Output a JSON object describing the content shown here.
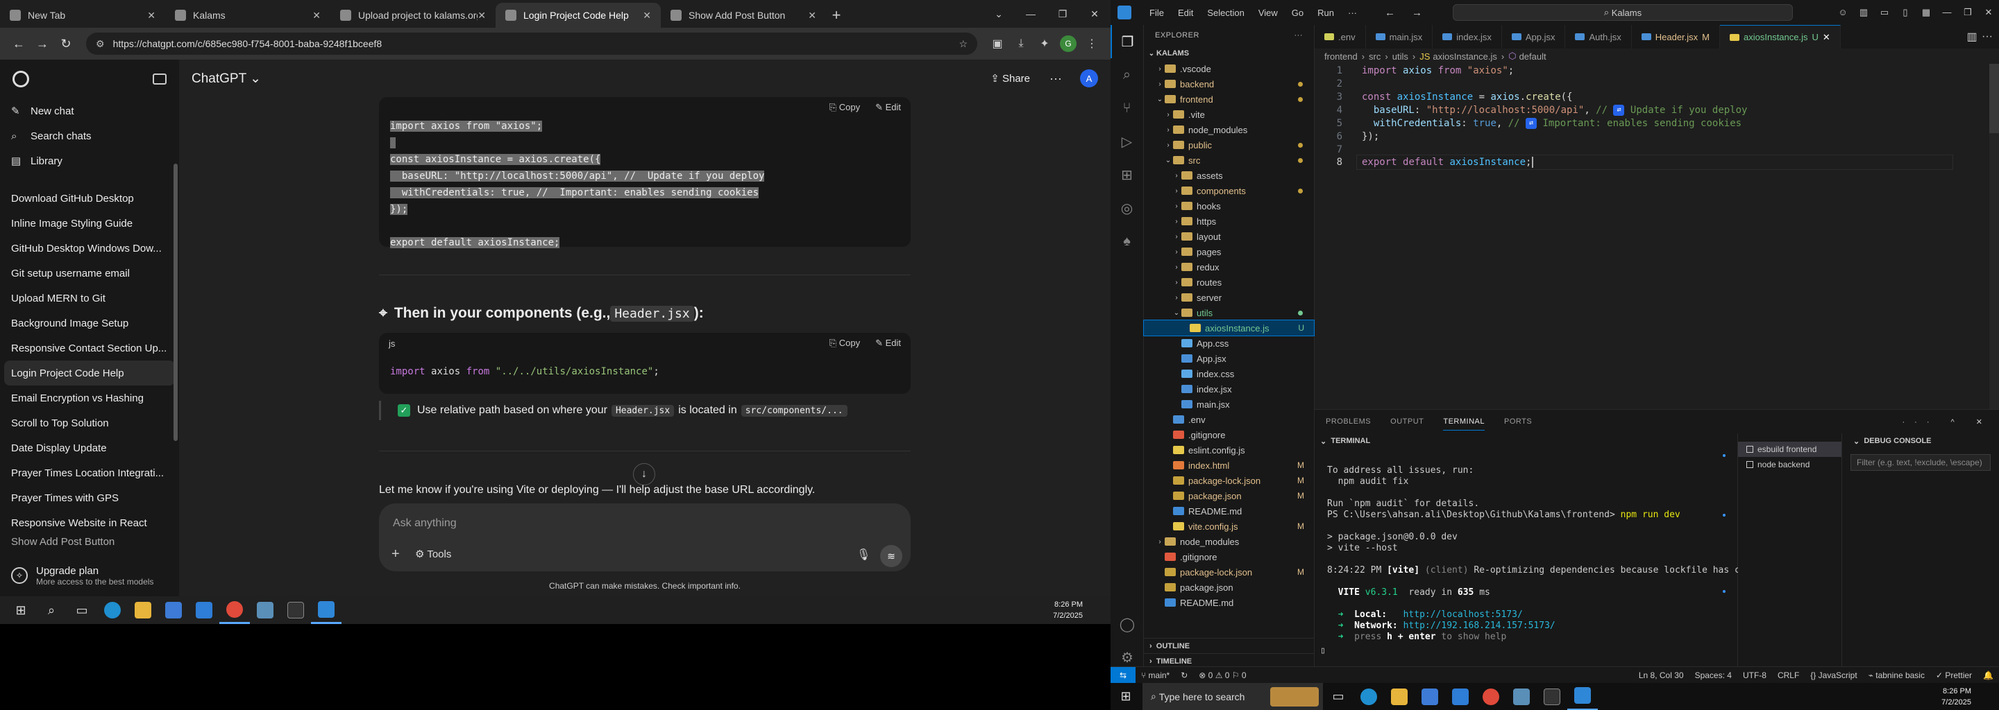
{
  "browser": {
    "tabs": [
      {
        "label": "New Tab",
        "close": "✕"
      },
      {
        "label": "Kalams",
        "close": "✕"
      },
      {
        "label": "Upload project to kalams.org",
        "close": "✕"
      },
      {
        "label": "Login Project Code Help",
        "close": "✕",
        "active": true
      },
      {
        "label": "Show Add Post Button",
        "close": "✕"
      }
    ],
    "new_tab": "+",
    "url": "https://chatgpt.com/c/685ec980-f754-8001-baba-9248f1bceef8"
  },
  "chatgpt": {
    "sidebar": {
      "actions": [
        {
          "icon": "✎",
          "label": "New chat"
        },
        {
          "icon": "⌕",
          "label": "Search chats"
        },
        {
          "icon": "▤",
          "label": "Library"
        }
      ],
      "history": [
        "Download GitHub Desktop",
        "Inline Image Styling Guide",
        "GitHub Desktop Windows Dow...",
        "Git setup username email",
        "Upload MERN to Git",
        "Background Image Setup",
        "Responsive Contact Section Up...",
        "Login Project Code Help",
        "Email Encryption vs Hashing",
        "Scroll to Top Solution",
        "Date Display Update",
        "Prayer Times Location Integrati...",
        "Prayer Times with GPS",
        "Responsive Website in React",
        "Show Add Post Button"
      ],
      "selected_index": 7,
      "upgrade_title": "Upgrade plan",
      "upgrade_sub": "More access to the best models"
    },
    "header": {
      "model": "ChatGPT",
      "share": "Share",
      "avatar": "A"
    },
    "code1": {
      "copy": "Copy",
      "edit": "Edit",
      "lines": [
        "import axios from \"axios\";",
        "",
        "const axiosInstance = axios.create({",
        "  baseURL: \"http://localhost:5000/api\", //  Update if you deploy",
        "  withCredentials: true, //  Important: enables sending cookies",
        "});",
        "",
        "export default axiosInstance;"
      ]
    },
    "section_heading_pre": "Then in your components (e.g., ",
    "section_heading_code": "Header.jsx",
    "section_heading_post": "):",
    "code2": {
      "lang": "js",
      "copy": "Copy",
      "edit": "Edit",
      "kw": "import",
      "ident": "axios",
      "from": "from",
      "path": "\"../../utils/axiosInstance\"",
      "semi": ";"
    },
    "note": {
      "pre": "Use relative path based on where your",
      "code1": "Header.jsx",
      "mid": "is located in",
      "code2": "src/components/..."
    },
    "last_message": "Let me know if you're using Vite or deploying — I'll help adjust the base URL accordingly.",
    "composer": {
      "placeholder": "Ask anything",
      "tools": "Tools"
    },
    "disclaimer": "ChatGPT can make mistakes. Check important info."
  },
  "left_taskbar": {
    "time": "8:26 PM",
    "date": "7/2/2025"
  },
  "vscode": {
    "menu": [
      "File",
      "Edit",
      "Selection",
      "View",
      "Go",
      "Run",
      "···"
    ],
    "search": "Kalams",
    "explorer_title": "EXPLORER",
    "root": "KALAMS",
    "tree": [
      {
        "name": ".vscode",
        "depth": 1,
        "type": "folder",
        "chev": "›"
      },
      {
        "name": "backend",
        "depth": 1,
        "type": "folder",
        "chev": "›",
        "color": "yel",
        "dot": true
      },
      {
        "name": "frontend",
        "depth": 1,
        "type": "folder",
        "chev": "⌄",
        "color": "yel",
        "dot": true
      },
      {
        "name": ".vite",
        "depth": 2,
        "type": "folder",
        "chev": "›"
      },
      {
        "name": "node_modules",
        "depth": 2,
        "type": "folder",
        "chev": "›"
      },
      {
        "name": "public",
        "depth": 2,
        "type": "folder",
        "chev": "›",
        "color": "yel",
        "dot": true
      },
      {
        "name": "src",
        "depth": 2,
        "type": "folder",
        "chev": "⌄",
        "color": "yel",
        "dot": true
      },
      {
        "name": "assets",
        "depth": 3,
        "type": "folder",
        "chev": "›"
      },
      {
        "name": "components",
        "depth": 3,
        "type": "folder",
        "chev": "›",
        "color": "yel",
        "dot": true
      },
      {
        "name": "hooks",
        "depth": 3,
        "type": "folder",
        "chev": "›"
      },
      {
        "name": "https",
        "depth": 3,
        "type": "folder",
        "chev": "›"
      },
      {
        "name": "layout",
        "depth": 3,
        "type": "folder",
        "chev": "›"
      },
      {
        "name": "pages",
        "depth": 3,
        "type": "folder",
        "chev": "›"
      },
      {
        "name": "redux",
        "depth": 3,
        "type": "folder",
        "chev": "›"
      },
      {
        "name": "routes",
        "depth": 3,
        "type": "folder",
        "chev": "›"
      },
      {
        "name": "server",
        "depth": 3,
        "type": "folder",
        "chev": "›"
      },
      {
        "name": "utils",
        "depth": 3,
        "type": "folder",
        "chev": "⌄",
        "color": "green",
        "dot": true,
        "dotgreen": true
      },
      {
        "name": "axiosInstance.js",
        "depth": 4,
        "type": "js",
        "color": "green",
        "badge": "U",
        "selected": true
      },
      {
        "name": "App.css",
        "depth": 3,
        "type": "css"
      },
      {
        "name": "App.jsx",
        "depth": 3,
        "type": "file"
      },
      {
        "name": "index.css",
        "depth": 3,
        "type": "css"
      },
      {
        "name": "index.jsx",
        "depth": 3,
        "type": "file"
      },
      {
        "name": "main.jsx",
        "depth": 3,
        "type": "file"
      },
      {
        "name": ".env",
        "depth": 2,
        "type": "file"
      },
      {
        "name": ".gitignore",
        "depth": 2,
        "type": "git"
      },
      {
        "name": "eslint.config.js",
        "depth": 2,
        "type": "js"
      },
      {
        "name": "index.html",
        "depth": 2,
        "type": "html",
        "color": "yel",
        "badge": "M"
      },
      {
        "name": "package-lock.json",
        "depth": 2,
        "type": "json",
        "color": "yel",
        "badge": "M"
      },
      {
        "name": "package.json",
        "depth": 2,
        "type": "json",
        "color": "yel",
        "badge": "M"
      },
      {
        "name": "README.md",
        "depth": 2,
        "type": "md"
      },
      {
        "name": "vite.config.js",
        "depth": 2,
        "type": "js",
        "color": "yel",
        "badge": "M"
      },
      {
        "name": "node_modules",
        "depth": 1,
        "type": "folder",
        "chev": "›"
      },
      {
        "name": ".gitignore",
        "depth": 1,
        "type": "git"
      },
      {
        "name": "package-lock.json",
        "depth": 1,
        "type": "json",
        "color": "yel",
        "badge": "M"
      },
      {
        "name": "package.json",
        "depth": 1,
        "type": "json"
      },
      {
        "name": "README.md",
        "depth": 1,
        "type": "md"
      }
    ],
    "outline": "OUTLINE",
    "timeline": "TIMELINE",
    "tabs": [
      {
        "label": ".env",
        "color": "#cfcf5a"
      },
      {
        "label": "main.jsx",
        "color": "#4a8fd6"
      },
      {
        "label": "index.jsx",
        "color": "#4a8fd6"
      },
      {
        "label": "App.jsx",
        "color": "#4a8fd6"
      },
      {
        "label": "Auth.jsx",
        "color": "#4a8fd6"
      },
      {
        "label": "Header.jsx",
        "color": "#4a8fd6",
        "mark": "M"
      },
      {
        "label": "axiosInstance.js",
        "color": "#e6c84a",
        "mark": "U",
        "active": true
      }
    ],
    "breadcrumb": [
      "frontend",
      "src",
      "utils",
      "axiosInstance.js",
      "default"
    ],
    "code": {
      "l1_kw": "import",
      "l1_id": "axios",
      "l1_from": "from",
      "l1_str": "\"axios\"",
      "l1_semi": ";",
      "l3_kw": "const",
      "l3_id": "axiosInstance",
      "l3_eq": " = ",
      "l3_obj": "axios",
      "l3_fn": "create",
      "l3_open": "({",
      "l4_prop": "baseURL",
      "l4_str": "\"http://localhost:5000/api\"",
      "l4_cmt": "Update if you deploy",
      "l5_prop": "withCredentials",
      "l5_val": "true",
      "l5_cmt": "Important: enables sending cookies",
      "l6": "});",
      "l8_kw1": "export",
      "l8_kw2": "default",
      "l8_id": "axiosInstance",
      "l8_semi": ";"
    },
    "panel_tabs": [
      "PROBLEMS",
      "OUTPUT",
      "TERMINAL",
      "PORTS"
    ],
    "terminal_title": "TERMINAL",
    "terminal": {
      "a1": "To address all issues, run:",
      "a2": "  npm audit fix",
      "a3": "Run `npm audit` for details.",
      "prompt": "PS C:\\Users\\ahsan.ali\\Desktop\\Github\\Kalams\\frontend>",
      "cmd": "npm run dev",
      "p1": "> package.json@0.0.0 dev",
      "p2": "> vite --host",
      "time": "8:24:22 PM",
      "vite_tag": "[vite]",
      "client": "(client)",
      "reopt": "Re-optimizing dependencies because lockfile has changed",
      "vite_name": "VITE",
      "vite_ver": "v6.3.1",
      "ready": "ready in",
      "ms": "635",
      "ms_unit": "ms",
      "local_lbl": "Local:",
      "local_url": "http://localhost:5173/",
      "net_lbl": "Network:",
      "net_url": "http://192.168.214.157:5173/",
      "help_pre": "press",
      "help_key": "h + enter",
      "help_post": "to show help"
    },
    "terminal_sessions": [
      "esbuild frontend",
      "node backend"
    ],
    "debug_title": "DEBUG CONSOLE",
    "debug_filter": "Filter (e.g. text, !exclude, \\escape)",
    "status": {
      "branch": "main*",
      "errors": "⊗ 0 ⚠ 0",
      "errors_extra": "0",
      "pos": "Ln 8, Col 30",
      "spaces": "Spaces: 4",
      "enc": "UTF-8",
      "eol": "CRLF",
      "lang": "JavaScript",
      "tabnine": "tabnine basic",
      "prettier": "Prettier"
    }
  },
  "right_taskbar": {
    "search": "Type here to search",
    "time": "8:26 PM",
    "date": "7/2/2025"
  }
}
